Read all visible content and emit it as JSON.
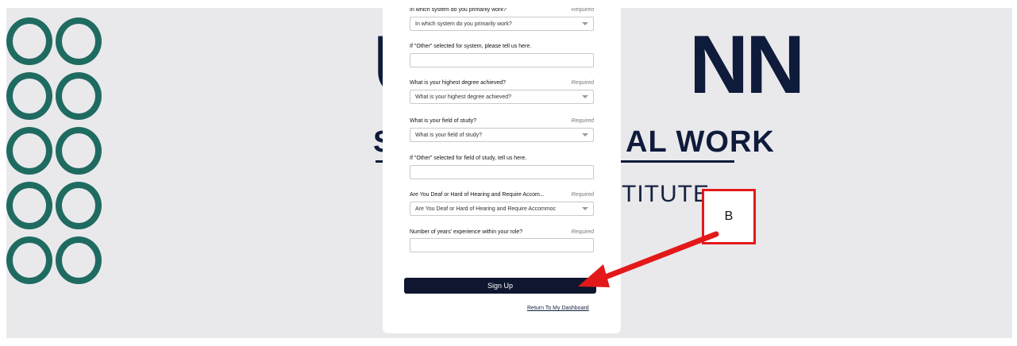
{
  "background": {
    "logo_top_letters_left": "U",
    "logo_top_letters_right": "NN",
    "logo_mid_left": "S",
    "logo_mid_right": "AL WORK",
    "logo_bottom": "TITUTE"
  },
  "form": {
    "rows": [
      {
        "label": "In which system do you primarily work?",
        "required": "Required",
        "value": "In which system do you primarily work?",
        "dropdown": true
      },
      {
        "label": "If \"Other\" selected for system, please tell us here.",
        "required": "",
        "value": "",
        "dropdown": false
      },
      {
        "label": "What is your highest degree achieved?",
        "required": "Required",
        "value": "What is your highest degree achieved?",
        "dropdown": true
      },
      {
        "label": "What is your field of study?",
        "required": "Required",
        "value": "What is your field of study?",
        "dropdown": true
      },
      {
        "label": "If \"Other\" selected for field of study, tell us here.",
        "required": "",
        "value": "",
        "dropdown": false
      },
      {
        "label": "Are You Deaf or Hard of Hearing and Require Accom...",
        "required": "Required",
        "value": "Are You Deaf or Hard of Hearing and Require Accommoc",
        "dropdown": true
      },
      {
        "label": "Number of years' experience within your role?",
        "required": "Required",
        "value": "",
        "dropdown": false
      }
    ],
    "signup_label": "Sign Up",
    "dashboard_link": "Return To My Dashboard"
  },
  "annotation": {
    "callout_label": "B",
    "color": "#e31919"
  },
  "colors": {
    "accent_green": "#1f6b61",
    "navy": "#0e1630"
  }
}
